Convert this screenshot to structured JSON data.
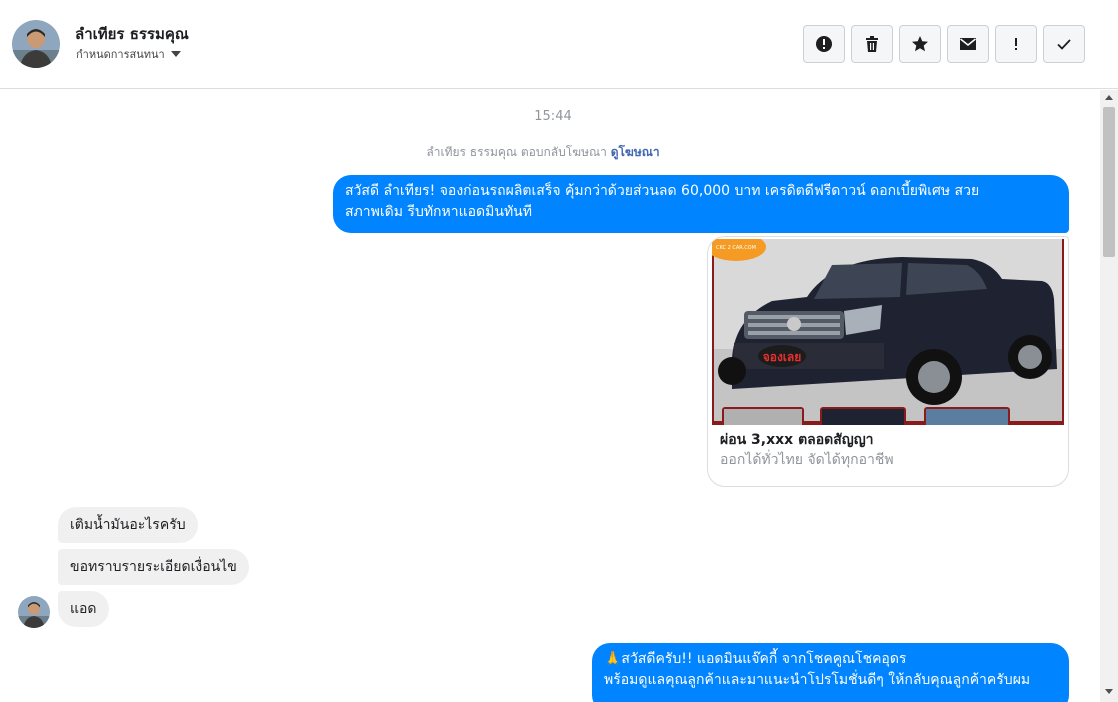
{
  "header": {
    "contact_name": "ลำเทียร ธรรมคุณ",
    "assign_label": "กำหนดการสนทนา",
    "icons": [
      "alert-circle-icon",
      "trash-icon",
      "star-icon",
      "envelope-icon",
      "exclamation-icon",
      "check-icon"
    ]
  },
  "chat": {
    "timestamp": "15:44",
    "ad_reply_text": "ลำเทียร ธรรมคุณ ตอบกลับโฆษณา",
    "ad_reply_link": "ดูโฆษณา",
    "outgoing_1_line1": "สวัสดี ลำเทียร! จองก่อนรถผลิตเสร็จ คุ้มกว่าด้วยส่วนลด 60,000 บาท เครดิตดีฟรีดาวน์ ดอกเบี้ยพิเศษ สวย",
    "outgoing_1_line2": "สภาพเดิม รีบทักหาแอดมินทันที",
    "ad_card": {
      "logo_text": "CKC 2 CAR.COM",
      "badge_text": "จองเลย",
      "title": "ผ่อน 3,xxx ตลอดสัญญา",
      "subtitle": "ออกได้ทั่วไทย จัดได้ทุกอาชีพ"
    },
    "incoming": [
      "เติมน้ำมันอะไรครับ",
      "ขอทราบรายระเอียดเงื่อนไข",
      "แอด"
    ],
    "outgoing_2_line1": "🙏สวัสดีครับ!! แอดมินแจ๊คกี้ จากโชคคูณโชคอุดร",
    "outgoing_2_line2": "พร้อมดูแลคุณลูกค้าและมาแนะนำโปรโมชั่นดีๆ ให้กลับคุณลูกค้าครับผม"
  },
  "colors": {
    "outgoing_bubble": "#0084ff",
    "incoming_bubble": "#f1f0f0",
    "link": "#4267b2",
    "muted_text": "#90949c"
  }
}
